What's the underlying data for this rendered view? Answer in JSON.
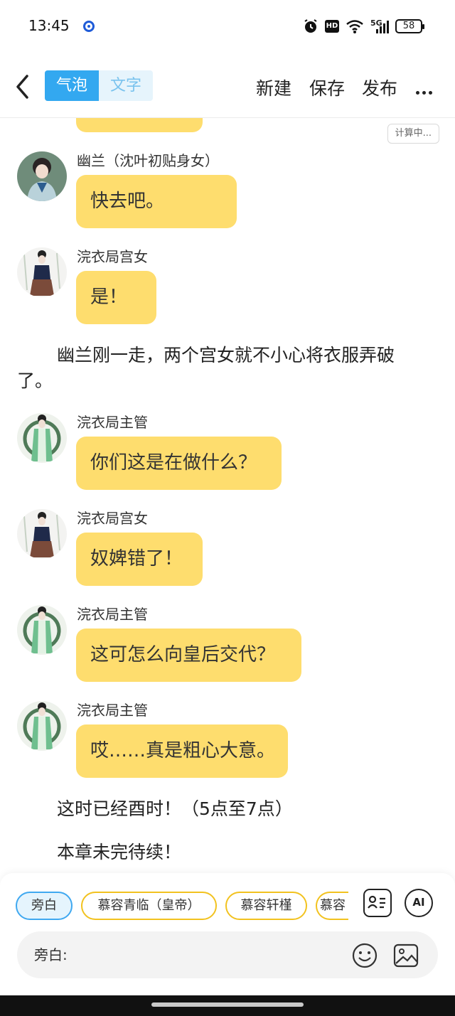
{
  "status_bar": {
    "time": "13:45",
    "battery": "58",
    "network": "5G",
    "hd": "HD"
  },
  "nav": {
    "tabs": [
      {
        "label": "气泡",
        "active": true
      },
      {
        "label": "文字",
        "active": false
      }
    ],
    "new_label": "新建",
    "save_label": "保存",
    "publish_label": "发布"
  },
  "calc_badge": "计算中...",
  "messages": [
    {
      "name": "幽兰（沈叶初贴身女）",
      "text": "快去吧。"
    },
    {
      "name": "浣衣局宫女",
      "text": "是！"
    },
    {
      "name": "浣衣局主管",
      "text": "你们这是在做什么？"
    },
    {
      "name": "浣衣局宫女",
      "text": "奴婢错了！"
    },
    {
      "name": "浣衣局主管",
      "text": "这可怎么向皇后交代？"
    },
    {
      "name": "浣衣局主管",
      "text": "哎……真是粗心大意。"
    }
  ],
  "narrations": [
    "幽兰刚一走，两个宫女就不小心将衣服弄破了。",
    "这时已经酉时！（5点至7点）",
    "本章未完待续！"
  ],
  "roles": [
    "旁白",
    "慕容青临（皇帝）",
    "慕容轩槿",
    "慕容"
  ],
  "ai_label": "AI",
  "input": {
    "placeholder": "旁白:"
  },
  "colors": {
    "bubble": "#fedd6e",
    "accent": "#33a8f0",
    "chip_border": "#f2c21f"
  }
}
